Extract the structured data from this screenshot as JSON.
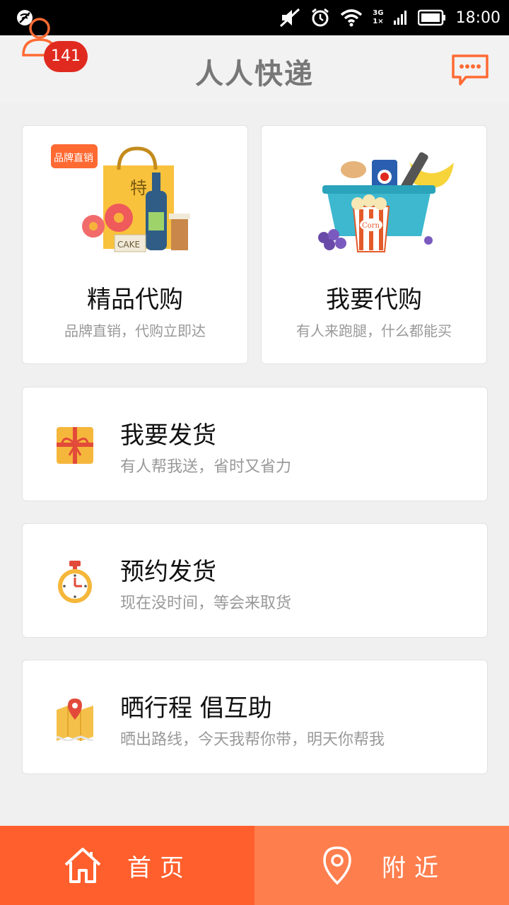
{
  "status_bar": {
    "network_top": "3G",
    "network_bottom": "1×",
    "time": "18:00"
  },
  "header": {
    "app_title": "人人快递",
    "badge_count": "141",
    "accent_color": "#ff6a33"
  },
  "cards": {
    "premium_purchase": {
      "title": "精品代购",
      "subtitle": "品牌直销，代购立即达",
      "tag": "品牌直销",
      "bag_text": "特",
      "cake_text": "CAKE"
    },
    "i_want_purchase": {
      "title": "我要代购",
      "subtitle": "有人来跑腿，什么都能买",
      "popcorn_text": "Corn"
    },
    "send_goods": {
      "title": "我要发货",
      "subtitle": "有人帮我送，省时又省力"
    },
    "schedule_delivery": {
      "title": "预约发货",
      "subtitle": "现在没时间，等会来取货"
    },
    "share_route": {
      "title": "晒行程 倡互助",
      "subtitle": "晒出路线，今天我帮你带，明天你帮我"
    }
  },
  "bottom_nav": {
    "home_label": "首页",
    "nearby_label": "附近"
  }
}
